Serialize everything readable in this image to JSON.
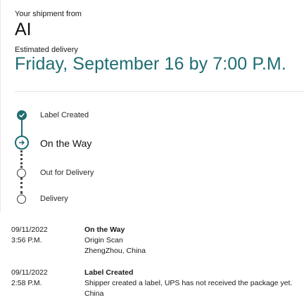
{
  "header": {
    "from_label": "Your shipment from",
    "shipper": "AI",
    "estimated_label": "Estimated delivery",
    "estimated_date": "Friday, September 16 by 7:00 P.M."
  },
  "progress": {
    "steps": [
      {
        "label": "Label Created",
        "state": "done"
      },
      {
        "label": "On the Way",
        "state": "current"
      },
      {
        "label": "Out for Delivery",
        "state": "pending"
      },
      {
        "label": "Delivery",
        "state": "pending"
      }
    ]
  },
  "history": [
    {
      "date": "09/11/2022",
      "time": "3:56 P.M.",
      "status": "On the Way",
      "lines": [
        "Origin Scan",
        "ZhengZhou, China"
      ]
    },
    {
      "date": "09/11/2022",
      "time": "2:58 P.M.",
      "status": "Label Created",
      "lines": [
        "Shipper created a label, UPS has not received the package yet.",
        "China"
      ]
    }
  ],
  "colors": {
    "accent": "#1f6d72",
    "text": "#121212"
  }
}
